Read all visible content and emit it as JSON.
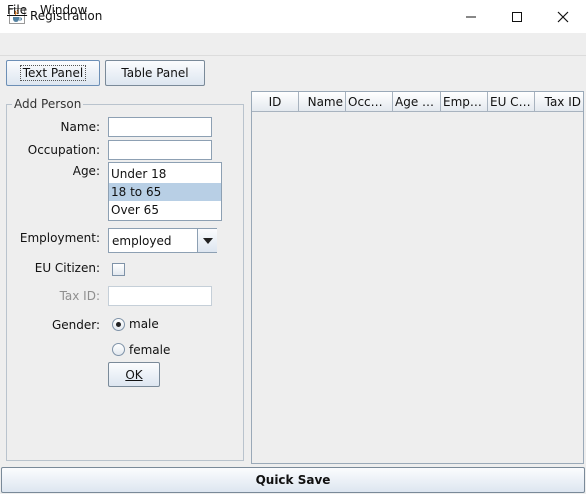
{
  "window": {
    "title": "Registration",
    "icon": "java-cup-icon"
  },
  "menu": {
    "items": [
      {
        "label": "File",
        "mnemonic": "F"
      },
      {
        "label": "Window",
        "mnemonic": ""
      }
    ]
  },
  "toolbar": {
    "text_panel_label": "Text Panel",
    "table_panel_label": "Table Panel"
  },
  "form": {
    "title": "Add Person",
    "name_label": "Name:",
    "name_value": "",
    "occupation_label": "Occupation:",
    "occupation_value": "",
    "age_label": "Age:",
    "age_options": [
      "Under 18",
      "18 to 65",
      "Over 65"
    ],
    "age_selected": "18 to 65",
    "employment_label": "Employment:",
    "employment_value": "employed",
    "eu_citizen_label": "EU Citizen:",
    "eu_citizen_checked": false,
    "taxid_label": "Tax ID:",
    "taxid_value": "",
    "gender_label": "Gender:",
    "gender_options": [
      "male",
      "female"
    ],
    "gender_selected": "male",
    "ok_label": "OK"
  },
  "table": {
    "columns": [
      "ID",
      "Name",
      "Occup...",
      "Age C...",
      "Emplo...",
      "EU Cit...",
      "Tax ID"
    ],
    "rows": []
  },
  "footer": {
    "quick_save_label": "Quick Save"
  },
  "colors": {
    "selection": "#b8cfe5",
    "background": "#eeeeee",
    "button_border": "#7a8a99"
  }
}
